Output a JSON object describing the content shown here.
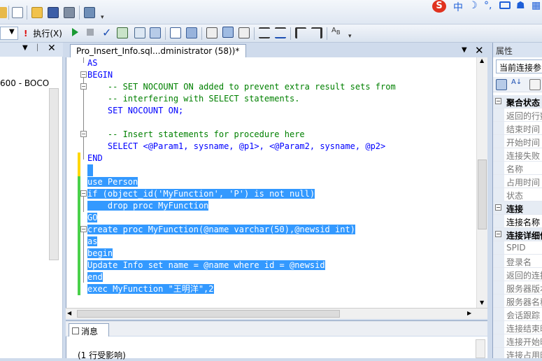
{
  "toolbar_top": {
    "ime_items": [
      "中"
    ],
    "ime_brand": "S"
  },
  "toolbar_query": {
    "execute_label": "执行(X)"
  },
  "left_pane": {
    "server_item": "600 - BOCO"
  },
  "editor": {
    "tab_title": "Pro_Insert_Info.sql...dministrator (58))*",
    "lines": [
      "AS",
      "BEGIN",
      "    -- SET NOCOUNT ON added to prevent extra result sets from",
      "    -- interfering with SELECT statements.",
      "    SET NOCOUNT ON;",
      "",
      "    -- Insert statements for procedure here",
      "    SELECT <@Param1, sysname, @p1>, <@Param2, sysname, @p2>",
      "END",
      "",
      "use Person",
      "if (object_id('MyFunction', 'P') is not null)",
      "    drop proc MyFunction",
      "GO",
      "create proc MyFunction(@name varchar(50),@newsid int)",
      "as",
      "begin",
      "Update Info set name = @name where id = @newsid",
      "end",
      "exec MyFunction \"王明洋\",2"
    ]
  },
  "results": {
    "tab_label": "消息",
    "message": "(1 行受影响)"
  },
  "properties": {
    "title": "属性",
    "dropdown": "当前连接参",
    "rows": [
      {
        "label": "聚合状态",
        "category": true
      },
      {
        "label": "返回的行数",
        "category": false
      },
      {
        "label": "结束时间",
        "category": false
      },
      {
        "label": "开始时间",
        "category": false
      },
      {
        "label": "连接失败",
        "category": false
      },
      {
        "label": "名称",
        "category": false
      },
      {
        "label": "占用时间",
        "category": false
      },
      {
        "label": "状态",
        "category": false
      },
      {
        "label": "连接",
        "category": true
      },
      {
        "label": "连接名称",
        "category": false
      },
      {
        "label": "连接详细信",
        "category": true
      },
      {
        "label": "SPID",
        "category": false
      },
      {
        "label": "登录名",
        "category": false
      },
      {
        "label": "返回的连接",
        "category": false
      },
      {
        "label": "服务器版本",
        "category": false
      },
      {
        "label": "服务器名称",
        "category": false
      },
      {
        "label": "会话跟踪",
        "category": false
      },
      {
        "label": "连接结束时",
        "category": false
      },
      {
        "label": "连接开始时",
        "category": false
      },
      {
        "label": "连接占用时",
        "category": false
      }
    ]
  }
}
